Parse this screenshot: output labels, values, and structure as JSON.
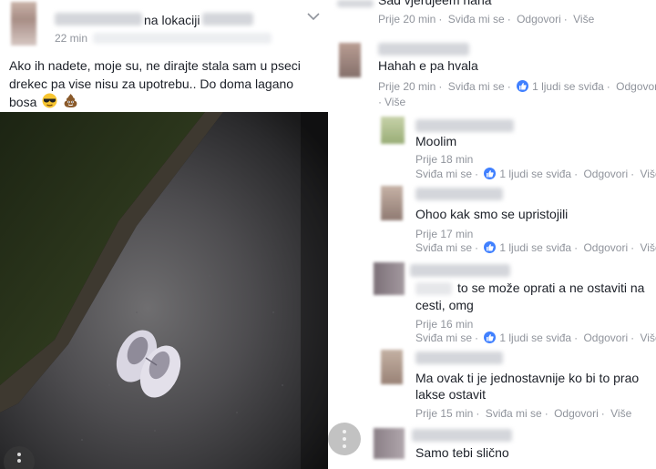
{
  "post": {
    "location_prefix": "na lokaciji",
    "time": "22 min",
    "text": "Ako ih nadete, moje su, ne dirajte stala sam u pseci drekec pa vise nisu za upotrebu.. Do doma lagano bosa",
    "emojis": [
      "sunglasses-emoji",
      "poop-emoji"
    ]
  },
  "comments": {
    "top_cut_text": "Sad vjerujeem haha",
    "actions": {
      "like": "Sviđa mi se",
      "reply": "Odgovori",
      "more": "Više",
      "likes_count": "1 ljudi se sviđa"
    },
    "items": [
      {
        "time": "Prije 20 min"
      },
      {
        "text": "Hahah e pa hvala",
        "time": "Prije 20 min"
      },
      {
        "text": "Moolim",
        "time": "Prije 18 min"
      },
      {
        "text": "Ohoo kak smo se upristojili",
        "time": "Prije 17 min"
      },
      {
        "text_line1": "to se može oprati a ne ostaviti na",
        "text_line2": "cesti, omg",
        "time": "Prije 16 min"
      },
      {
        "text_line1": "Ma ovak ti je jednostavnije ko bi to prao",
        "text_line2": "lakse ostavit",
        "time": "Prije 15 min"
      },
      {
        "text": "Samo tebi slično"
      }
    ]
  },
  "colors": {
    "meta_gray": "#90949c",
    "text": "#1d2129",
    "like_blue": "#4080ff",
    "photo_dark": "#161512"
  }
}
